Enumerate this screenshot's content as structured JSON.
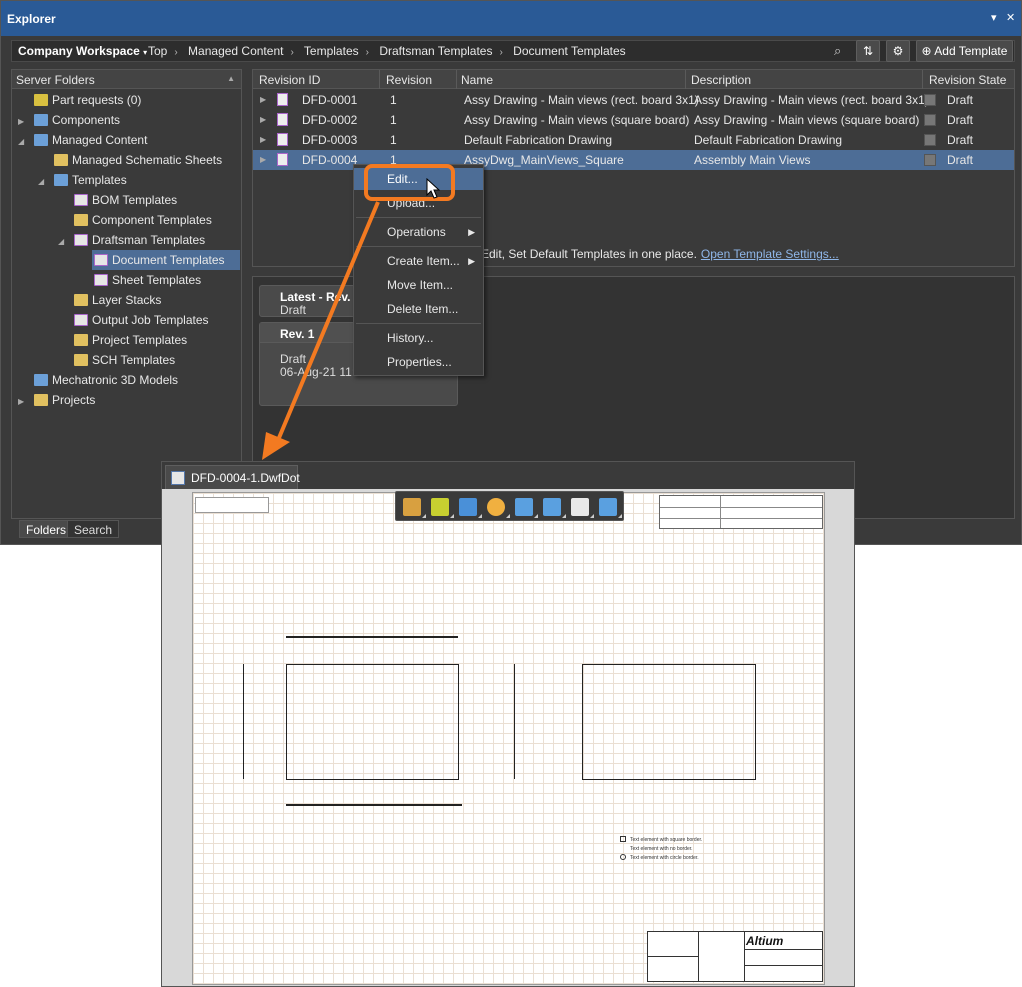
{
  "window": {
    "title": "Explorer",
    "controls": [
      "▾",
      "✕"
    ]
  },
  "nav": {
    "workspace": "Company Workspace",
    "breadcrumbs": [
      "Top",
      "Managed Content",
      "Templates",
      "Draftsman Templates",
      "Document Templates"
    ],
    "add_template_label": "Add Template"
  },
  "left": {
    "header": "Server Folders",
    "items": [
      {
        "label": "Part requests (0)"
      },
      {
        "label": "Components"
      },
      {
        "label": "Managed Content"
      },
      {
        "label": "Managed Schematic Sheets"
      },
      {
        "label": "Templates"
      },
      {
        "label": "BOM Templates"
      },
      {
        "label": "Component Templates"
      },
      {
        "label": "Draftsman Templates"
      },
      {
        "label": "Document Templates"
      },
      {
        "label": "Sheet Templates"
      },
      {
        "label": "Layer Stacks"
      },
      {
        "label": "Output Job Templates"
      },
      {
        "label": "Project Templates"
      },
      {
        "label": "SCH Templates"
      },
      {
        "label": "Mechatronic 3D Models"
      },
      {
        "label": "Projects"
      }
    ],
    "tabs": [
      "Folders",
      "Search"
    ]
  },
  "grid": {
    "columns": [
      "Revision ID",
      "Revision",
      "Name",
      "Description",
      "Revision State"
    ],
    "rows": [
      {
        "id": "DFD-0001",
        "rev": "1",
        "name": "Assy Drawing - Main views (rect. board 3x1)",
        "desc": "Assy Drawing - Main views (rect. board 3x1)",
        "state": "Draft"
      },
      {
        "id": "DFD-0002",
        "rev": "1",
        "name": "Assy Drawing - Main views (square board)",
        "desc": "Assy Drawing - Main views (square board)",
        "state": "Draft"
      },
      {
        "id": "DFD-0003",
        "rev": "1",
        "name": "Default Fabrication Drawing",
        "desc": "Default Fabrication Drawing",
        "state": "Draft"
      },
      {
        "id": "DFD-0004",
        "rev": "1",
        "name": "AssyDwg_MainViews_Square",
        "desc": "Assembly Main Views",
        "state": "Draft"
      }
    ],
    "info_text": "Edit, Set Default Templates in one place.",
    "info_link": "Open Template Settings..."
  },
  "detail": {
    "latest_title": "Latest - Rev. 1",
    "latest_state": "Draft",
    "rev_title": "Rev. 1",
    "rev_state": "Draft",
    "rev_date": "06-Aug-21 11:4"
  },
  "context_menu": {
    "items": [
      "Edit...",
      "Upload...",
      "Operations",
      "Create Item...",
      "Move Item...",
      "Delete Item...",
      "History...",
      "Properties..."
    ]
  },
  "document": {
    "tab_label": "DFD-0004-1.DwfDot",
    "logo_text": "Altium",
    "legend": [
      "Text element with square border.",
      "Text element with no border.",
      "Text element with circle border."
    ]
  },
  "colors": {
    "accent": "#f37a21",
    "selection": "#4d6d96",
    "title_bar": "#2a5a96"
  }
}
